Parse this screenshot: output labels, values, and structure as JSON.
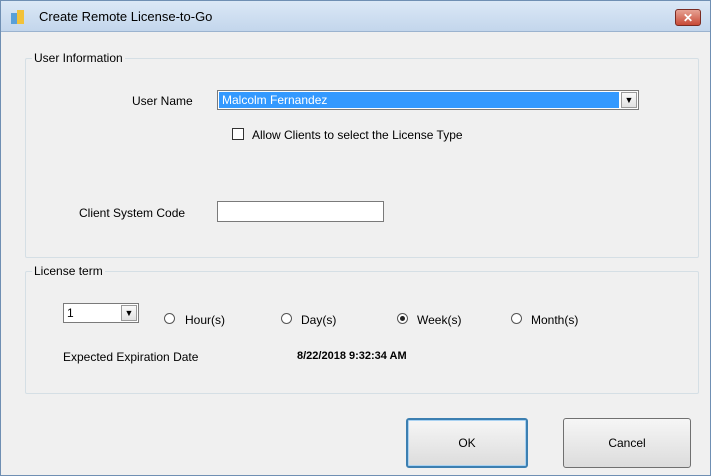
{
  "window": {
    "title": "Create Remote License-to-Go"
  },
  "user_info": {
    "legend": "User Information",
    "user_name_label": "User Name",
    "user_name_value": "Malcolm Fernandez",
    "allow_clients_label": "Allow Clients to select the License Type",
    "allow_clients_checked": false,
    "client_system_code_label": "Client System Code",
    "client_system_code_value": ""
  },
  "license_term": {
    "legend": "License term",
    "count_value": "1",
    "units": [
      {
        "label": "Hour(s)",
        "checked": false
      },
      {
        "label": "Day(s)",
        "checked": false
      },
      {
        "label": "Week(s)",
        "checked": true
      },
      {
        "label": "Month(s)",
        "checked": false
      }
    ],
    "expiration_label": "Expected Expiration Date",
    "expiration_value": "8/22/2018 9:32:34 AM"
  },
  "buttons": {
    "ok": "OK",
    "cancel": "Cancel"
  }
}
